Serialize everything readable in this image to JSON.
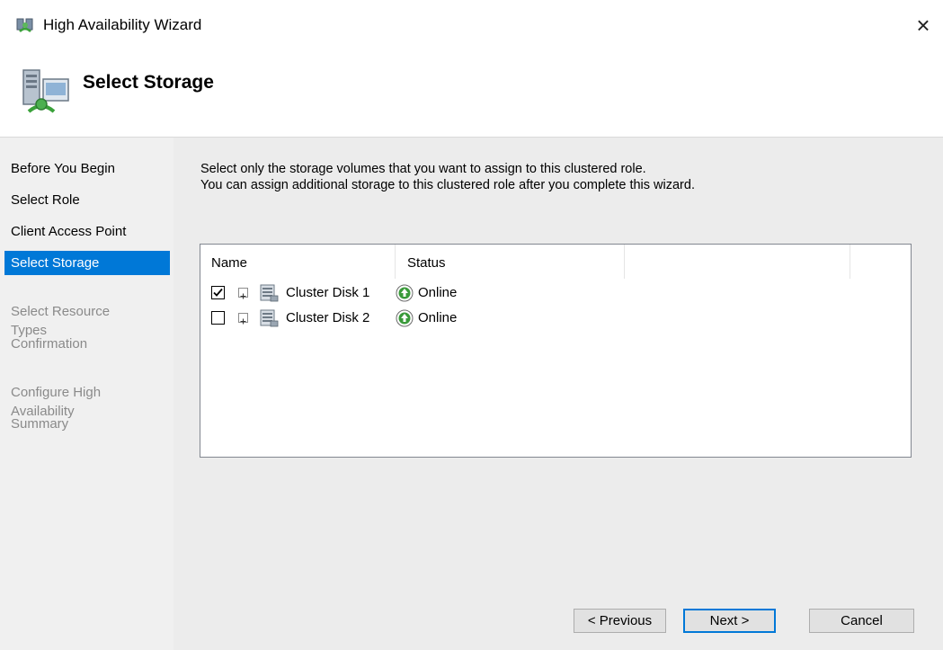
{
  "window": {
    "title": "High Availability Wizard",
    "close_glyph": "×",
    "icon": "wizard-cluster-icon"
  },
  "header": {
    "title": "Select Storage",
    "icon": "storage-wizard-icon"
  },
  "sidebar": {
    "items": [
      {
        "label": "Before You Begin",
        "state": "done"
      },
      {
        "label": "Select Role",
        "state": "done"
      },
      {
        "label": "Client Access Point",
        "state": "done"
      },
      {
        "label": "Select Storage",
        "state": "current"
      },
      {
        "label": "Select Resource\nTypes",
        "state": "pending"
      },
      {
        "label": "Confirmation",
        "state": "pending"
      },
      {
        "label": "Configure High\nAvailability",
        "state": "pending"
      },
      {
        "label": "Summary",
        "state": "pending"
      }
    ]
  },
  "main": {
    "description_line1": "Select only the storage volumes that you want to assign to this clustered role.",
    "description_line2": "You can assign additional storage to this clustered role after you complete this wizard.",
    "table": {
      "columns": [
        "Name",
        "Status"
      ],
      "rows": [
        {
          "checked": true,
          "name": "Cluster Disk 1",
          "status": "Online"
        },
        {
          "checked": false,
          "name": "Cluster Disk 2",
          "status": "Online"
        }
      ]
    }
  },
  "buttons": {
    "previous": "< Previous",
    "next": "Next >",
    "cancel": "Cancel"
  },
  "colors": {
    "accent": "#0078d7",
    "sidebar_bg": "#f0f0f0",
    "content_bg": "#ececec",
    "status_green": "#3a9a3a"
  }
}
